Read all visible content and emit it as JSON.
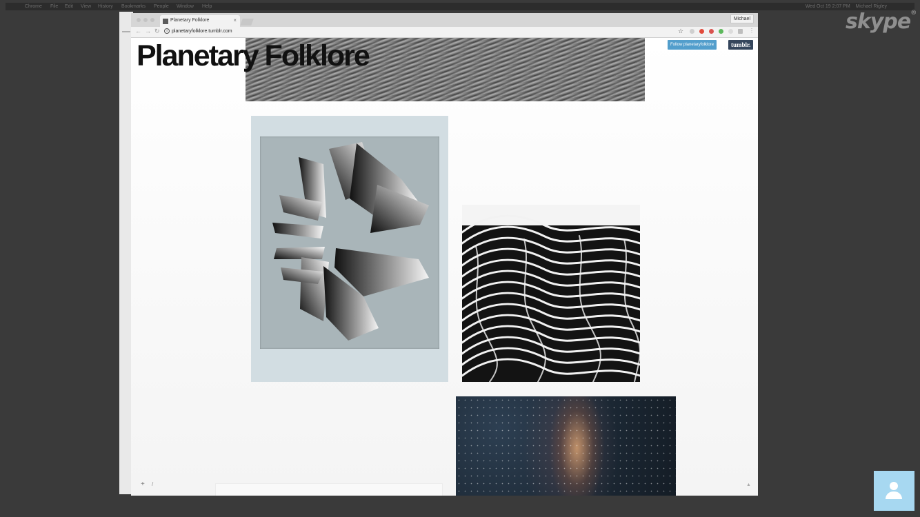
{
  "menubar": {
    "items": [
      "Chrome",
      "File",
      "Edit",
      "View",
      "History",
      "Bookmarks",
      "People",
      "Window",
      "Help"
    ],
    "datetime": "Wed Oct 19 2:07 PM",
    "user": "Michael Rigley"
  },
  "skype": {
    "logo": "skype"
  },
  "browser": {
    "tab_title": "Planetary Folklore",
    "tab_close": "×",
    "profile": "Michael",
    "url": "planetaryfolklore.tumblr.com"
  },
  "blog": {
    "title": "Planetary Folklore",
    "follow_label": "Follow planetaryfolklore",
    "tumblr_label": "tumblr.",
    "bottom_plus": "+",
    "bottom_slash": "/",
    "scroll_up": "▲"
  },
  "colors": {
    "follow": "#529ecc",
    "tumblr": "#35465c",
    "selfview": "#a7d8f1"
  },
  "icons": [
    "apple-icon",
    "back-icon",
    "forward-icon",
    "reload-icon",
    "info-icon",
    "star-icon",
    "menu-icon",
    "user-icon"
  ]
}
